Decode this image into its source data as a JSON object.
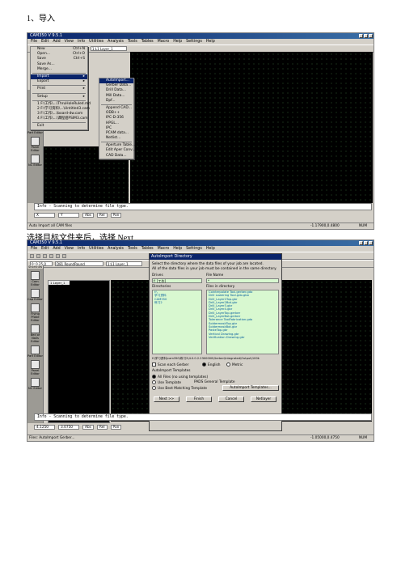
{
  "step_heading": "1、导入",
  "caption": "选择目标文件夹后，选择 Next",
  "screen1": {
    "title": "CAM350 V 9.5.1",
    "menu": [
      "File",
      "Edit",
      "Add",
      "View",
      "Info",
      "Utilities",
      "Analysis",
      "Tools",
      "Tables",
      "Macro",
      "Help",
      "Settings",
      "Help"
    ],
    "layer_combo": "1:L1 Layer_1",
    "file_menu": [
      {
        "label": "New",
        "key": "Ctrl+N"
      },
      {
        "label": "Open...",
        "key": "Ctrl+O"
      },
      {
        "label": "Save",
        "key": "Ctrl+S"
      },
      {
        "label": "Save As...",
        "key": ""
      },
      {
        "label": "Merge...",
        "key": ""
      },
      {
        "label": "Import",
        "key": "▸"
      },
      {
        "label": "Export",
        "key": "▸"
      },
      {
        "label": "Print",
        "key": "▸"
      },
      {
        "label": "Setup",
        "key": "▸"
      },
      {
        "label": "1 F:\\工作\\...\\ThruHoleRuled.md",
        "key": ""
      },
      {
        "label": "2 F:\\学习资料\\...\\Untitled3.cam",
        "key": ""
      },
      {
        "label": "3 F:\\工作\\...\\board-dw.cam",
        "key": ""
      },
      {
        "label": "4 F:\\工作\\...\\课程组PSIM3.cam",
        "key": ""
      },
      {
        "label": "Exit",
        "key": ""
      }
    ],
    "import_menu": [
      "AutoImport...",
      "Gerber Data...",
      "Drill Data...",
      "Mill Data...",
      "Dpf...",
      "Append CAD...",
      "ODB++",
      "IPC-D-356",
      "HPGL...",
      "IPC",
      "PCAM data...",
      "Netlist...",
      "Aperture Table...",
      "Edit Aper Conv...",
      "CAD Data..."
    ],
    "sidebar": [
      "Cam Editor",
      "Cap Editor",
      "Flying Probe Editor",
      "Bed of Nails Editor",
      "Part Editor",
      "Panel Editor",
      "NC Editor"
    ],
    "command_text": "Info - Scanning to determine file type.",
    "status_x": "X",
    "status_y": "Y",
    "status_mode": "Abs",
    "status_rel": "Rel",
    "status_pan": "Pan",
    "status_left": "Auto Import all CAM files",
    "status_coords": "-1.17900,0.4800",
    "status_num": "NUM"
  },
  "screen2": {
    "title": "CAM350 V 9.5.1",
    "menu": [
      "File",
      "Edit",
      "Add",
      "View",
      "Info",
      "Utilities",
      "Analysis",
      "Tools",
      "Tables",
      "Macro",
      "Help",
      "Settings",
      "Help"
    ],
    "combo1": "0: 0.25,0",
    "combo2": "D81 RoundRound",
    "combo3": "1:L1 Layer_1",
    "shortcuts": "Shortcuts",
    "layer_name": "1 Layer_1",
    "sidebar": [
      "Cam Editor",
      "Cap Editor",
      "Flying Probe Editor",
      "Bed of Nails Editor",
      "Part Editor",
      "Panel Editor",
      "NC Editor"
    ],
    "dialog": {
      "title": "AutoImport Directory",
      "hint1": "Select the directory where the data files of your job are located.",
      "hint2": "All of the data files in your job must be contained in the same directory.",
      "drives_label": "Drives",
      "drive_value": "f: [工作]",
      "file_name_label": "File Name",
      "file_name_value": "*",
      "directories_label": "Directories",
      "directories": [
        "f:\\",
        "学习资料",
        "CAM350",
        "练习2"
      ],
      "files_label": "Files in directory",
      "files": [
        "Cointerpolate Toxi.gerber.gdo",
        "Drill Lowering Tool.gdo.gbo",
        "Drill_Layer1Top.gbr",
        "Drill_Layer2Bot.gbr",
        "Drill_Layer3.gbr",
        "Drill_Layer4.gbr",
        "Drill_LayerTop.gerber",
        "Drill_LayerBot.gerber",
        "Tolerance ToolFabrication.gdo",
        "SoldermaskTop.gbr",
        "SoldermaskBot.gbr",
        "PasteTop.gbr",
        "Vertical Drawing.gbr",
        "Verification Drawing.gbr"
      ],
      "path_text": "f:\\学习资料\\cam350\\练习2\\4.0.0.2.2300000\\Gerber\\Integrated\\Output\\100k",
      "scan_each": "Scan each Gerber",
      "english": "English",
      "metric": "Metric",
      "templates_label": "AutoImport Templates",
      "opt_all": "All Files (no using templates)",
      "opt_use": "Use Template",
      "opt_template_value": "PADS General Template",
      "opt_best": "Use Best Matching Template",
      "btn_templates": "AutoImport Templates...",
      "btn_next": "Next >>",
      "btn_finish": "Finish",
      "btn_cancel": "Cancel",
      "btn_netlayer": "Netlayer"
    },
    "command_text": "Info - Scanning to determine file type.",
    "status_x": "4.1250",
    "status_y": "3.0750",
    "status_mode": "Abs",
    "status_rel": "Rel",
    "status_pan": "Pan",
    "status_left": "Files: AutoImport Gerber...",
    "status_coords": "-1.05000,0.4750",
    "status_num": "NUM"
  }
}
